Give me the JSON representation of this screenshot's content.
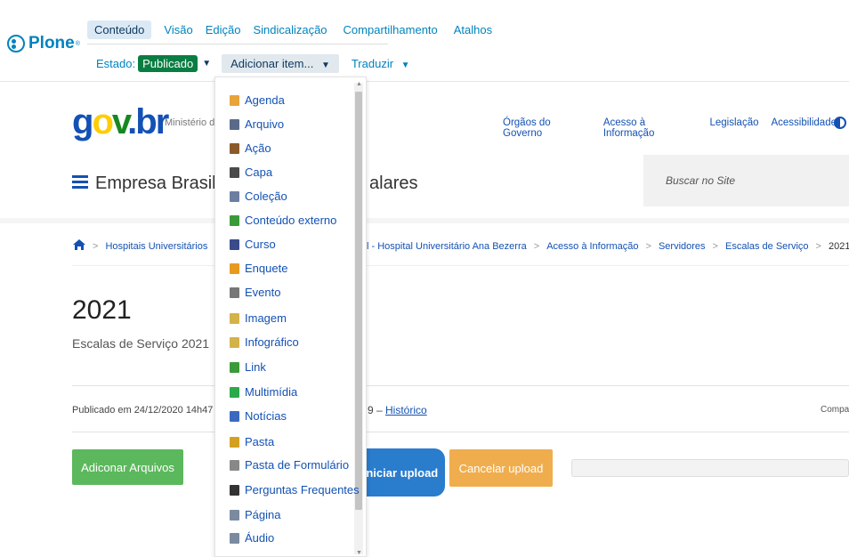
{
  "toolbar": {
    "logo": "Plone",
    "tabs": [
      {
        "label": "Conteúdo",
        "active": true
      },
      {
        "label": "Visão"
      },
      {
        "label": "Edição"
      },
      {
        "label": "Sindicalização"
      },
      {
        "label": "Compartilhamento"
      },
      {
        "label": "Atalhos"
      }
    ],
    "state_label": "Estado:",
    "state_value": "Publicado",
    "add_item": "Adicionar item...",
    "translate": "Traduzir"
  },
  "header": {
    "ministerio": "Ministério da",
    "links": [
      "Órgãos do Governo",
      "Acesso à Informação",
      "Legislação",
      "Acessibilidade"
    ],
    "site_name_start": "Empresa Brasilei",
    "site_name_end": "alares",
    "search_placeholder": "Buscar no Site"
  },
  "breadcrumb": {
    "first": "Hospitais Universitários",
    "items": [
      "l - Hospital Universitário Ana Bezerra",
      "Acesso à Informação",
      "Servidores",
      "Escalas de Serviço"
    ],
    "current": "2021"
  },
  "content": {
    "title": "2021",
    "description": "Escalas de Serviço 2021",
    "published": "Publicado em 24/12/2020 14h47",
    "history_prefix": "9 – ",
    "history_link": "Histórico",
    "share": "Compar"
  },
  "actions": {
    "add_files": "Adiconar Arquivos",
    "start_upload": "Iniciar upload",
    "cancel_upload": "Cancelar upload"
  },
  "menu": {
    "items": [
      {
        "label": "Agenda",
        "icon": "calendar-icon",
        "color": "#e8a33a"
      },
      {
        "label": "Arquivo",
        "icon": "file-icon",
        "color": "#5a6b8a"
      },
      {
        "label": "Ação",
        "icon": "clipboard-icon",
        "color": "#8b5a2b"
      },
      {
        "label": "Capa",
        "icon": "layout-icon",
        "color": "#4a4a4a"
      },
      {
        "label": "Coleção",
        "icon": "collection-icon",
        "color": "#6c7fa0"
      },
      {
        "label": "Conteúdo externo",
        "icon": "globe-icon",
        "color": "#3a9a3a"
      },
      {
        "label": "Curso",
        "icon": "book-icon",
        "color": "#3a4a8a"
      },
      {
        "label": "Enquete",
        "icon": "poll-icon",
        "color": "#e89a20"
      },
      {
        "label": "Evento",
        "icon": "event-icon",
        "color": "#777777"
      },
      {
        "label": "Imagem",
        "icon": "image-icon",
        "color": "#d4b24a"
      },
      {
        "label": "Infográfico",
        "icon": "infographic-icon",
        "color": "#d4b24a"
      },
      {
        "label": "Link",
        "icon": "link-icon",
        "color": "#3a9a3a"
      },
      {
        "label": "Multimídia",
        "icon": "media-icon",
        "color": "#2aaa4a"
      },
      {
        "label": "Notícias",
        "icon": "news-icon",
        "color": "#3a6ac0"
      },
      {
        "label": "Pasta",
        "icon": "folder-icon",
        "color": "#d4a020"
      },
      {
        "label": "Pasta de Formulário",
        "icon": "form-folder-icon",
        "color": "#888888"
      },
      {
        "label": "Perguntas Frequentes",
        "icon": "faq-icon",
        "color": "#333333"
      },
      {
        "label": "Página",
        "icon": "page-icon",
        "color": "#7a8aa0"
      },
      {
        "label": "Áudio",
        "icon": "audio-icon",
        "color": "#7a8aa0"
      }
    ]
  }
}
